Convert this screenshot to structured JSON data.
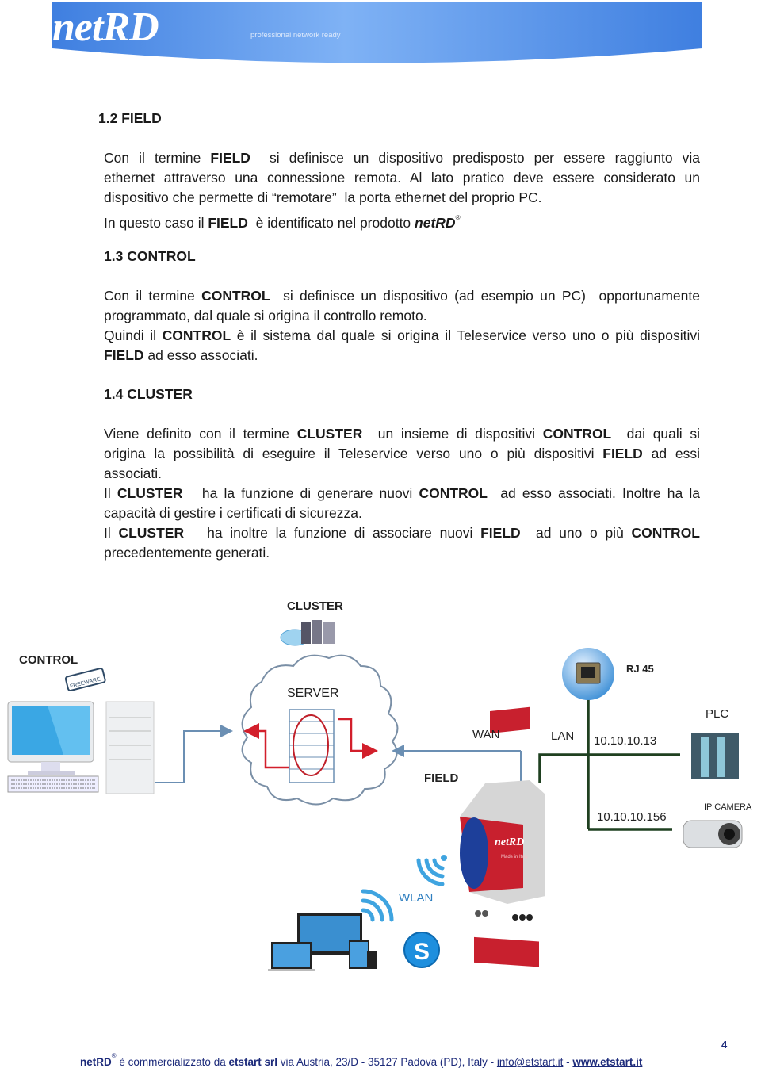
{
  "header": {
    "logo": "netRD",
    "tagline": "professional network ready",
    "colors": {
      "banner_light": "#7fb2f5",
      "banner_dark": "#3f7fe0"
    }
  },
  "sections": [
    {
      "heading": "1.2  FIELD",
      "lines": [
        [
          "Con il termine ",
          {
            "b": "FIELD"
          },
          "  si definisce un dispositivo predisposto per essere raggiunto via"
        ],
        [
          "ethernet attraverso una connessione remota. Al lato pratico deve essere considerato un"
        ],
        [
          "dispositivo che permette di “remotare”  la porta ethernet del proprio PC."
        ],
        [
          "In questo caso il ",
          {
            "b": "FIELD"
          },
          "  è identificato nel prodotto ",
          {
            "bi": "netRD"
          },
          {
            "sup": "®"
          }
        ]
      ]
    },
    {
      "heading": "1.3  CONTROL",
      "lines": [
        [
          "Con il termine ",
          {
            "b": "CONTROL"
          },
          "  si definisce un dispositivo (ad esempio un PC)  opportunamente"
        ],
        [
          "programmato, dal quale si origina il controllo remoto."
        ],
        [
          "Quindi il ",
          {
            "b": "CONTROL"
          },
          " è il sistema dal quale si origina il Teleservice verso uno o più dispositivi"
        ],
        [
          {
            "b": "FIELD"
          },
          " ad esso associati."
        ]
      ]
    },
    {
      "heading": "1.4  CLUSTER",
      "lines": [
        [
          "Viene definito con il termine ",
          {
            "b": "CLUSTER"
          },
          "  un insieme di dispositivi ",
          {
            "b": "CONTROL"
          },
          "  dai quali si"
        ],
        [
          "origina la possibilità di eseguire il Teleservice verso uno o più dispositivi ",
          {
            "b": "FIELD"
          },
          " ad essi"
        ],
        [
          "associati."
        ],
        [
          "Il ",
          {
            "b": "CLUSTER"
          },
          "   ha la funzione di generare nuovi ",
          {
            "b": "CONTROL"
          },
          "  ad esso associati. Inoltre ha la"
        ],
        [
          "capacità di gestire i certificati di sicurezza."
        ],
        [
          "Il ",
          {
            "b": "CLUSTER"
          },
          "   ha inoltre la funzione di associare nuovi ",
          {
            "b": "FIELD"
          },
          "  ad uno o più ",
          {
            "b": "CONTROL"
          }
        ],
        [
          "precedentemente generati."
        ]
      ]
    }
  ],
  "diagram": {
    "labels": {
      "cluster": "CLUSTER",
      "control": "CONTROL",
      "freeware": "FREEWARE",
      "server": "SERVER",
      "wan": "WAN",
      "lan": "LAN",
      "field": "FIELD",
      "rj45": "RJ 45",
      "plc": "PLC",
      "ip_plc": "10.10.10.13",
      "ip_camera_addr": "10.10.10.156",
      "ip_camera": "IP CAMERA",
      "wlan": "WLAN",
      "device_brand": "netRD",
      "device_sub": "Made in Italy",
      "skype": "S"
    },
    "colors": {
      "red_arrow": "#d21f2b",
      "blue_line": "#6b8fb3",
      "lan_line": "#1f4020",
      "cloud": "#7a8fa6"
    }
  },
  "footer": {
    "brand": "netRD",
    "reg": "®",
    "text1": " è commercializzato da ",
    "company": "etstart srl",
    "address": " via Austria, 23/D - 35127 Padova (PD), Italy - ",
    "email": "info@etstart.it",
    "sep": " - ",
    "website": "www.etstart.it",
    "page_number": "4"
  }
}
